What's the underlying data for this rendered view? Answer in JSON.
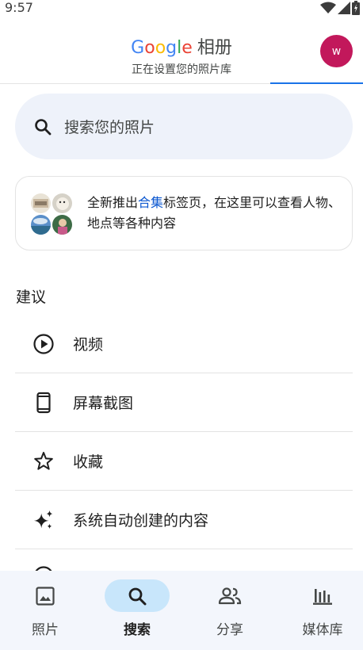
{
  "status_bar": {
    "time": "9:57"
  },
  "header": {
    "brand_google": [
      "G",
      "o",
      "o",
      "g",
      "l",
      "e"
    ],
    "product": "相册",
    "subtitle": "正在设置您的照片库",
    "avatar_initial": "w",
    "avatar_color": "#c2185b"
  },
  "search": {
    "placeholder": "搜索您的照片"
  },
  "promo": {
    "text_before": "全新推出",
    "link": "合集",
    "text_after": "标签页，在这里可以查看人物、地点等各种内容"
  },
  "suggestions": {
    "title": "建议",
    "items": [
      {
        "label": "视频",
        "icon": "play-circle-icon"
      },
      {
        "label": "屏幕截图",
        "icon": "phone-icon"
      },
      {
        "label": "收藏",
        "icon": "star-icon"
      },
      {
        "label": "系统自动创建的内容",
        "icon": "sparkle-icon"
      },
      {
        "label": "",
        "icon": "partial-icon"
      }
    ]
  },
  "bottom_nav": {
    "items": [
      {
        "label": "照片",
        "icon": "photo-icon"
      },
      {
        "label": "搜索",
        "icon": "search-icon",
        "active": true
      },
      {
        "label": "分享",
        "icon": "people-icon"
      },
      {
        "label": "媒体库",
        "icon": "library-icon"
      }
    ]
  },
  "colors": {
    "accent": "#1a73e8",
    "link": "#0b57d0",
    "active_pill": "#c8e6fb",
    "nav_bg": "#f3f6fc",
    "search_bg": "#eef2fa"
  }
}
